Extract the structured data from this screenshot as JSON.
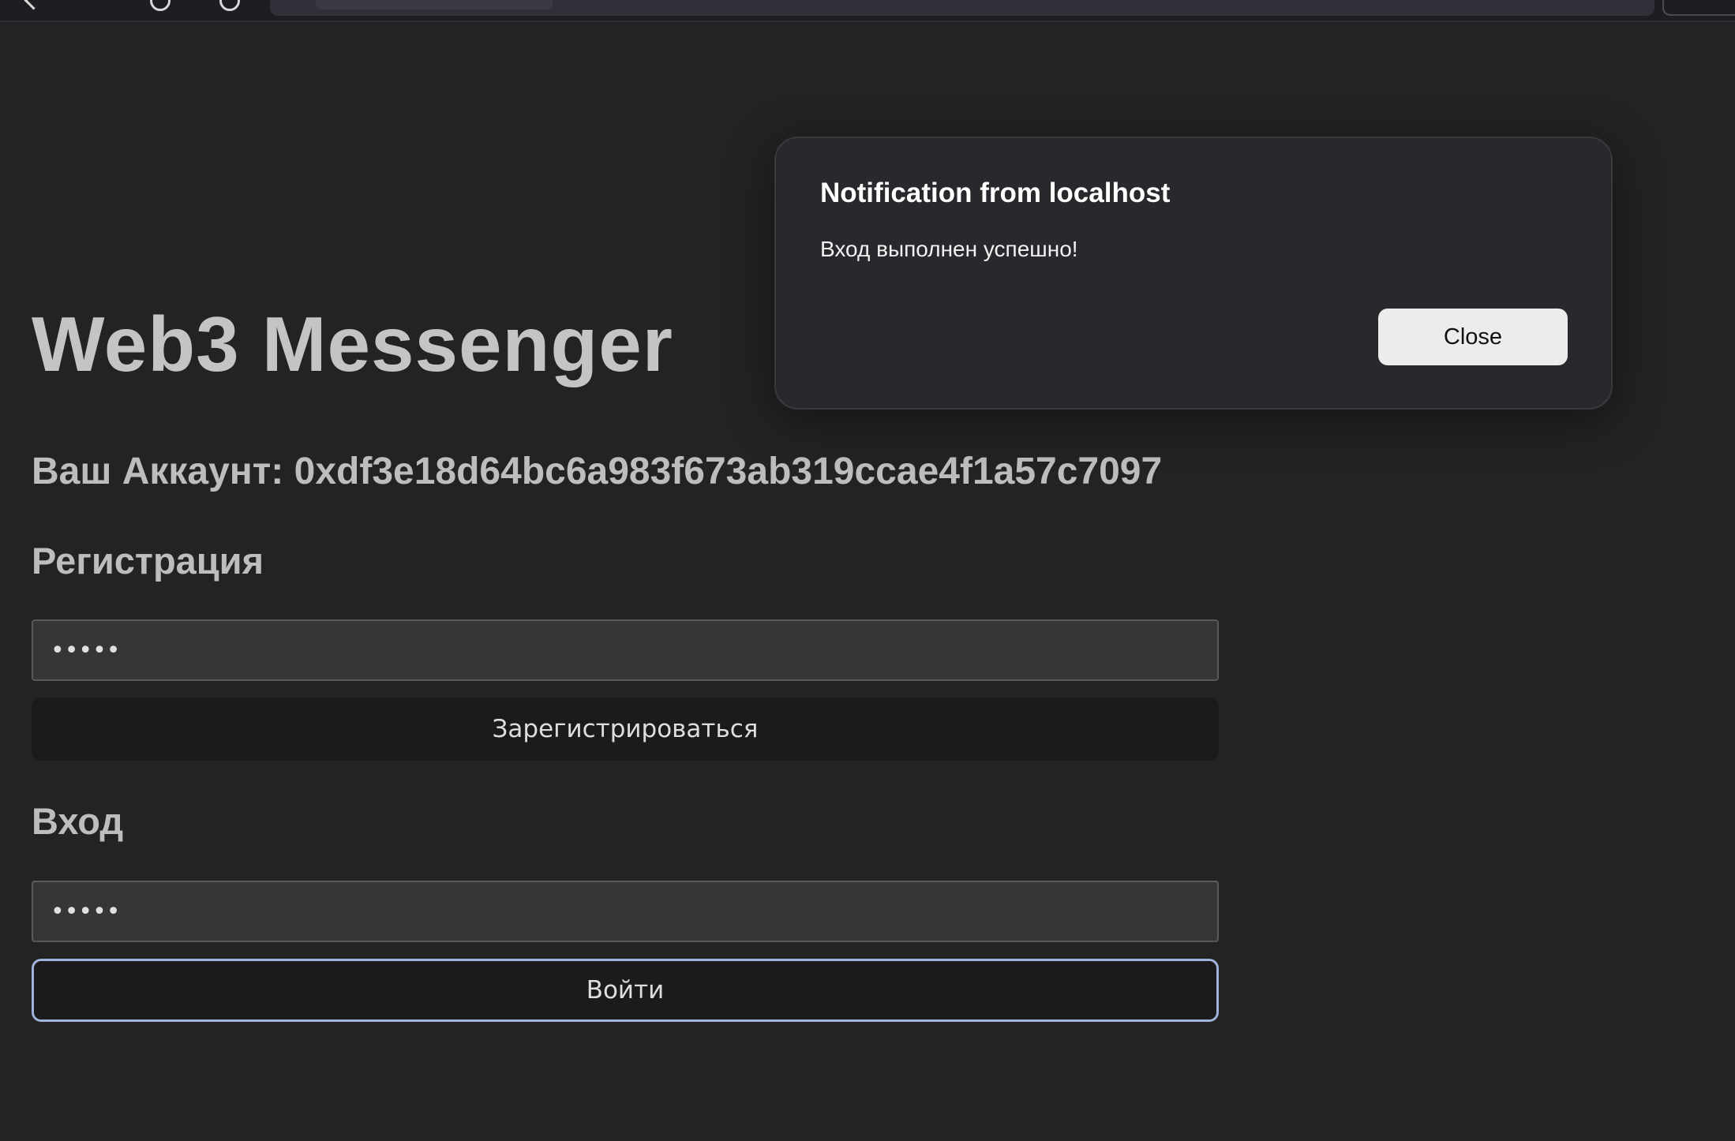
{
  "browser": {
    "back_icon": "back-arrow-icon",
    "reload_icon": "reload-icon"
  },
  "page": {
    "title": "Web3 Messenger",
    "account_line": "Ваш Аккаунт: 0xdf3e18d64bc6a983f673ab319ccae4f1a57c7097"
  },
  "register": {
    "heading": "Регистрация",
    "input_value": "•••••",
    "button_label": "Зарегистрироваться"
  },
  "login": {
    "heading": "Вход",
    "input_value": "•••••",
    "button_label": "Войти"
  },
  "dialog": {
    "title": "Notification from localhost",
    "message": "Вход выполнен успешно!",
    "close_label": "Close"
  },
  "colors": {
    "background": "#232323",
    "dialog_background": "#28282d",
    "focus_ring": "#9fb3dc"
  }
}
